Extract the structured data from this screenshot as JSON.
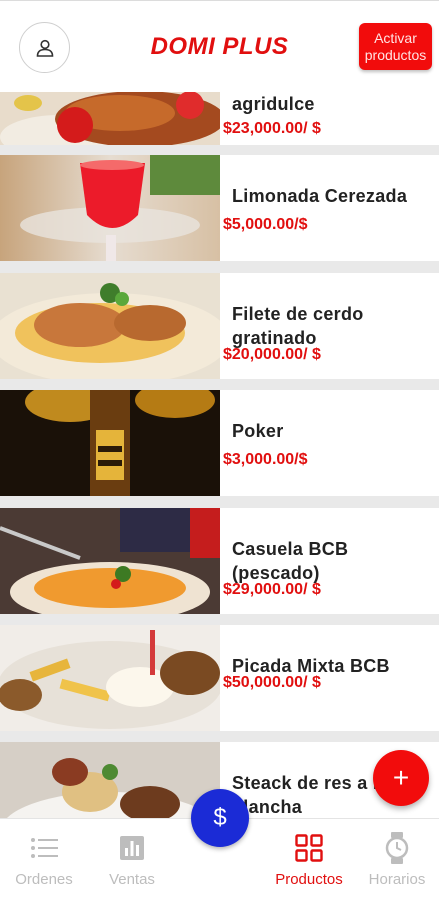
{
  "header": {
    "title": "DOMI PLUS",
    "activate_label": "Activar productos"
  },
  "products": [
    {
      "name": "agridulce",
      "price": "$23,000.00/ $"
    },
    {
      "name": "Limonada Cerezada",
      "price": "$5,000.00/$"
    },
    {
      "name": "Filete de cerdo gratinado",
      "price": "$20,000.00/ $"
    },
    {
      "name": "Poker",
      "price": "$3,000.00/$"
    },
    {
      "name": "Casuela BCB (pescado)",
      "price": "$29,000.00/ $"
    },
    {
      "name": "Picada Mixta BCB",
      "price": "$50,000.00/ $"
    },
    {
      "name": "Steack de res a la plancha",
      "price": ""
    }
  ],
  "nav": {
    "ordenes": "Ordenes",
    "ventas": "Ventas",
    "productos": "Productos",
    "horarios": "Horarios"
  },
  "fab": {
    "add": "+",
    "dollar": "$"
  },
  "colors": {
    "accent": "#e10f0f",
    "fab_blue": "#1b2bd6",
    "inactive": "#bdbdbd"
  }
}
